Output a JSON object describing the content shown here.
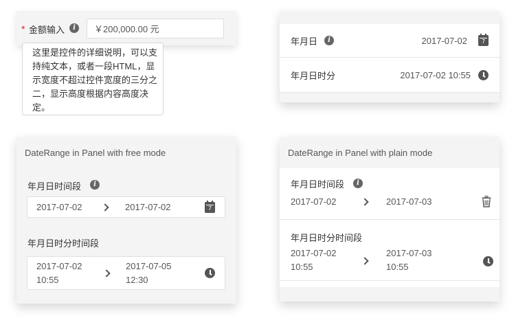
{
  "amount": {
    "required_mark": "*",
    "label": "金额输入",
    "value": "￥200,000.00 元",
    "tooltip": "这里是控件的详细说明，可以支持纯文本，或者一段HTML，显示宽度不超过控件宽度的三分之二，显示高度根据内容高度决定。"
  },
  "date_card": {
    "rows": [
      {
        "label": "年月日",
        "value": "2017-07-02",
        "icon": "calendar-icon",
        "calendar_day": "7"
      },
      {
        "label": "年月日时分",
        "value": "2017-07-02 10:55",
        "icon": "clock-icon"
      }
    ]
  },
  "free_panel": {
    "title": "DateRange in Panel with free mode",
    "range1": {
      "label": "年月日时间段",
      "start": "2017-07-02",
      "end": "2017-07-02",
      "calendar_day": "7"
    },
    "range2": {
      "label": "年月日时分时间段",
      "start_date": "2017-07-02",
      "start_time": "10:55",
      "end_date": "2017-07-05",
      "end_time": "12:30"
    }
  },
  "plain_panel": {
    "title": "DateRange in Panel with plain mode",
    "range1": {
      "label": "年月日时间段",
      "start": "2017-07-02",
      "end": "2017-07-03"
    },
    "range2": {
      "label": "年月日时分时间段",
      "start_date": "2017-07-02",
      "start_time": "10:55",
      "end_date": "2017-07-03",
      "end_time": "10:55"
    }
  },
  "colors": {
    "required": "#e02020",
    "icon": "#555555",
    "panel_header": "#f4f4f4",
    "divider": "#e6e6e6"
  }
}
